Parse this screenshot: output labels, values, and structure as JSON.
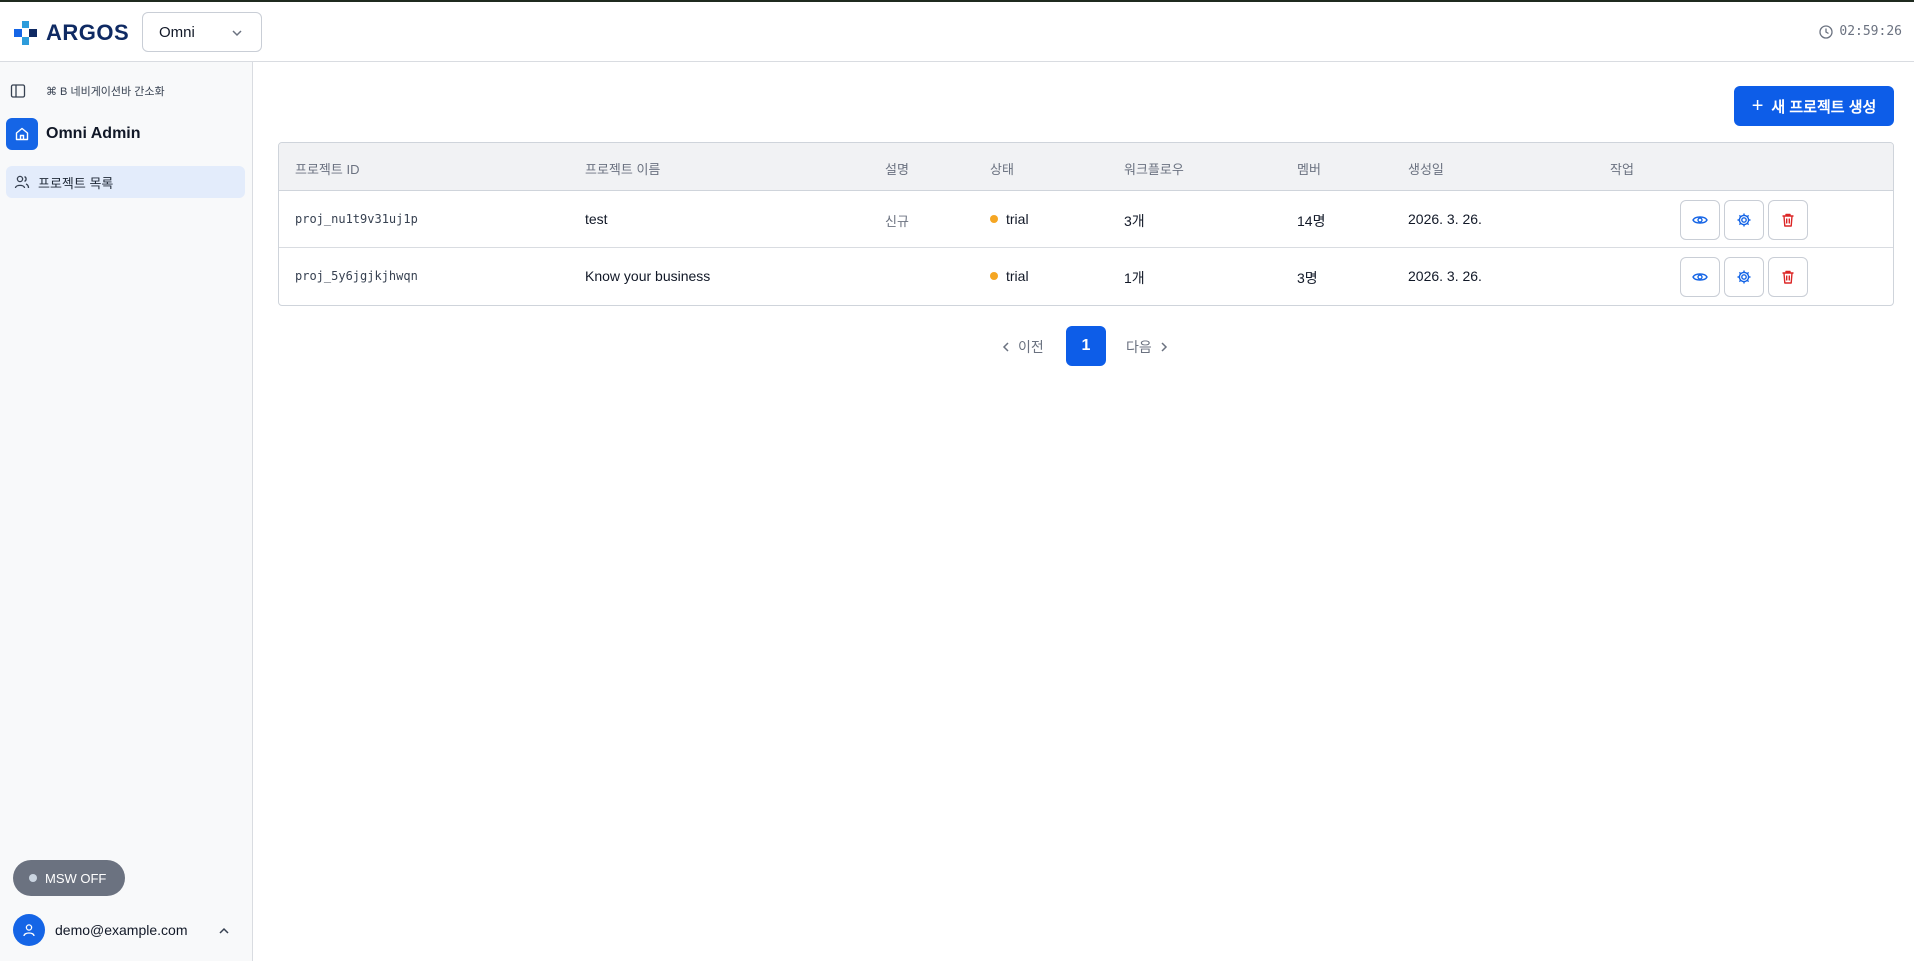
{
  "app": {
    "logo_text": "ARGOS",
    "org_select_value": "Omni",
    "clock": "02:59:26",
    "accent_color": "#0d5de8"
  },
  "sidebar": {
    "toggle_hint": "⌘ B 네비게이션바 간소화",
    "title": "Omni Admin",
    "items": [
      {
        "label": "프로젝트 목록",
        "icon": "users-icon",
        "active": true
      }
    ],
    "msw_label": "MSW OFF",
    "user_email": "demo@example.com"
  },
  "main": {
    "new_project_label": "새 프로젝트 생성",
    "table": {
      "headers": [
        "프로젝트 ID",
        "프로젝트 이름",
        "설명",
        "상태",
        "워크플로우",
        "멤버",
        "생성일",
        "작업"
      ],
      "rows": [
        {
          "id": "proj_nu1t9v31uj1p",
          "name": "test",
          "description": "신규",
          "status": "trial",
          "workflows": "3개",
          "members": "14명",
          "created": "2026. 3. 26."
        },
        {
          "id": "proj_5y6jgjkjhwqn",
          "name": "Know your business",
          "description": "",
          "status": "trial",
          "workflows": "1개",
          "members": "3명",
          "created": "2026. 3. 26."
        }
      ],
      "status_color": "#f5a623",
      "action_icons": [
        "eye-icon",
        "gear-icon",
        "trash-icon"
      ]
    },
    "pagination": {
      "prev_label": "이전",
      "current_page": "1",
      "next_label": "다음"
    }
  }
}
